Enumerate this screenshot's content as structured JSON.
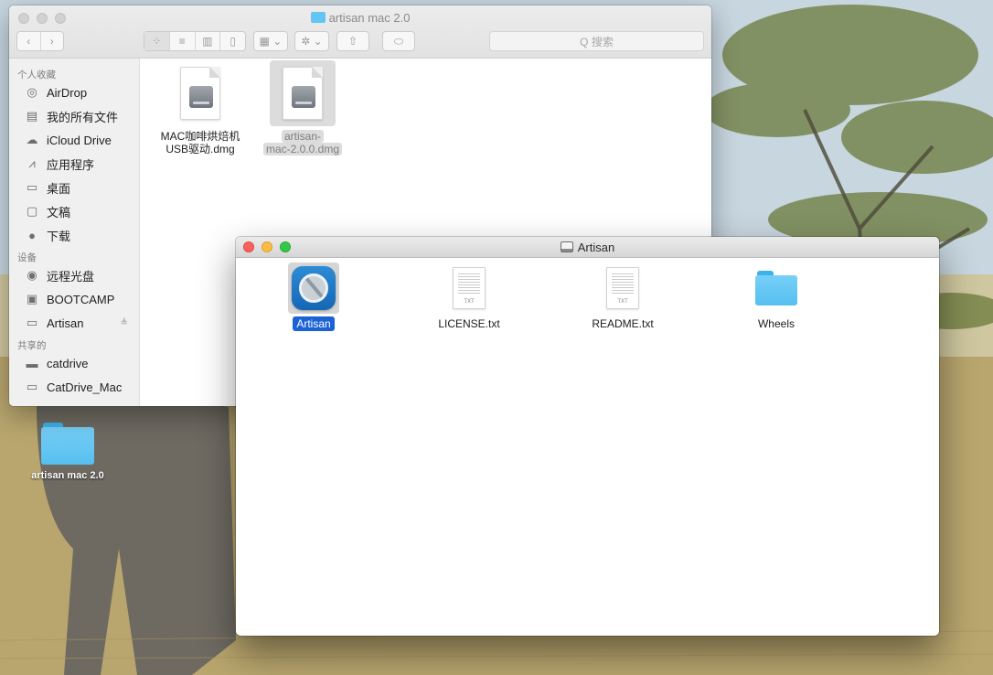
{
  "desktop": {
    "folder_label": "artisan mac 2.0"
  },
  "back_window": {
    "title": "artisan mac 2.0",
    "search_placeholder": "Q 搜索",
    "sidebar": {
      "sections": [
        {
          "heading": "个人收藏",
          "items": [
            {
              "label": "AirDrop",
              "icon": "airdrop-icon"
            },
            {
              "label": "我的所有文件",
              "icon": "all-files-icon"
            },
            {
              "label": "iCloud Drive",
              "icon": "cloud-icon"
            },
            {
              "label": "应用程序",
              "icon": "applications-icon"
            },
            {
              "label": "桌面",
              "icon": "desktop-icon"
            },
            {
              "label": "文稿",
              "icon": "documents-icon"
            },
            {
              "label": "下载",
              "icon": "download-icon"
            }
          ]
        },
        {
          "heading": "设备",
          "items": [
            {
              "label": "远程光盘",
              "icon": "disc-icon"
            },
            {
              "label": "BOOTCAMP",
              "icon": "drive-icon"
            },
            {
              "label": "Artisan",
              "icon": "drive-icon",
              "eject": "≜"
            }
          ]
        },
        {
          "heading": "共享的",
          "items": [
            {
              "label": "catdrive",
              "icon": "monitor-icon"
            },
            {
              "label": "CatDrive_Mac",
              "icon": "server-icon"
            }
          ]
        }
      ]
    },
    "files": [
      {
        "name_line1": "MAC咖啡烘焙机",
        "name_line2": "USB驱动.dmg",
        "icon": "dmg-icon"
      },
      {
        "name_line1": "artisan-",
        "name_line2": "mac-2.0.0.dmg",
        "icon": "dmg-icon"
      }
    ]
  },
  "front_window": {
    "title": "Artisan",
    "items": [
      {
        "name": "Artisan",
        "icon": "artisan-app-icon",
        "selected": true
      },
      {
        "name": "LICENSE.txt",
        "icon": "text-file-icon",
        "tag": "TXT"
      },
      {
        "name": "README.txt",
        "icon": "text-file-icon",
        "tag": "TXT"
      },
      {
        "name": "Wheels",
        "icon": "folder-icon"
      }
    ]
  },
  "colors": {
    "selection_blue": "#1b62d6",
    "folder_blue": "#56bff0",
    "close_red": "#fc605c",
    "minimize_yellow": "#fdbc40",
    "maximize_green": "#34c84a"
  }
}
